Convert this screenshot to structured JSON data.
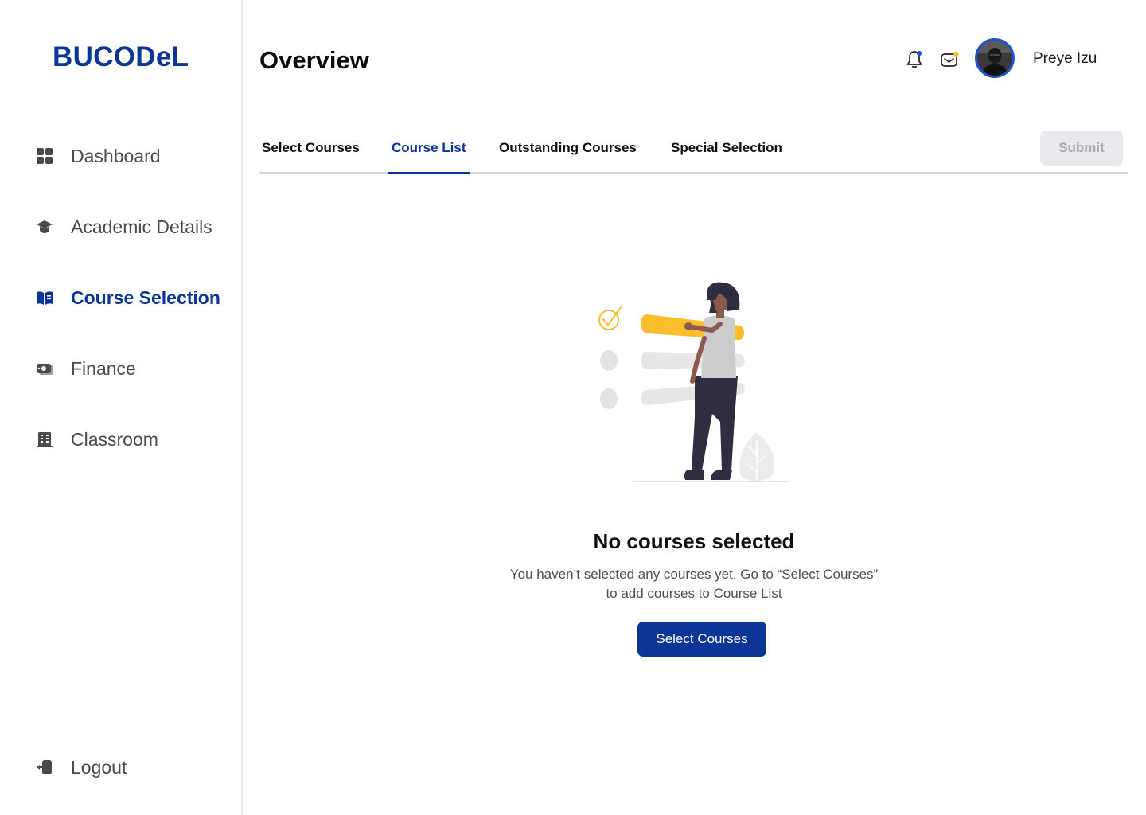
{
  "app": {
    "logo_text": "BUCODeL",
    "brand_color": "#0b3596"
  },
  "sidebar": {
    "items": [
      {
        "label": "Dashboard",
        "icon": "dashboard-grid-icon",
        "active": false
      },
      {
        "label": "Academic Details",
        "icon": "graduation-cap-icon",
        "active": false
      },
      {
        "label": "Course Selection",
        "icon": "open-book-icon",
        "active": true
      },
      {
        "label": "Finance",
        "icon": "money-icon",
        "active": false
      },
      {
        "label": "Classroom",
        "icon": "building-icon",
        "active": false
      }
    ],
    "logout_label": "Logout",
    "logout_icon": "logout-icon"
  },
  "header": {
    "title": "Overview",
    "notification_icon": "bell-icon",
    "message_icon": "mail-icon",
    "user_name": "Preye Izu",
    "avatar_icon": "avatar"
  },
  "tabs": {
    "items": [
      {
        "label": "Select Courses",
        "active": false
      },
      {
        "label": "Course List",
        "active": true
      },
      {
        "label": "Outstanding Courses",
        "active": false
      },
      {
        "label": "Special Selection",
        "active": false
      }
    ],
    "submit_label": "Submit",
    "submit_disabled": true
  },
  "empty_state": {
    "title": "No courses selected",
    "description_line1": "You haven’t selected any courses yet. Go to “Select Courses”",
    "description_line2": "to add courses to Course List",
    "button_label": "Select Courses"
  },
  "colors": {
    "accent": "#0b3596",
    "avatar_ring": "#1a56d6",
    "illustration_yellow": "#fbbd2b",
    "illustration_dark": "#2f2e41",
    "notification_dot_bell": "#1a56d6",
    "notification_dot_mail": "#fbbd2b"
  }
}
